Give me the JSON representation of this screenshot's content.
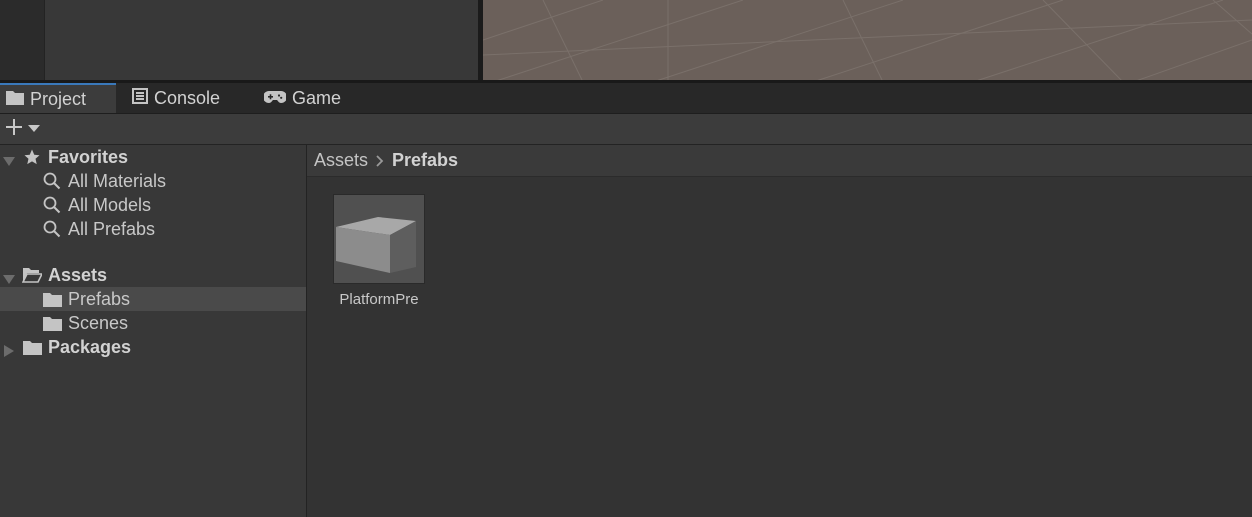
{
  "tabs": {
    "project": {
      "label": "Project",
      "icon": "folder-icon"
    },
    "console": {
      "label": "Console",
      "icon": "console-icon"
    },
    "game": {
      "label": "Game",
      "icon": "gamepad-icon"
    }
  },
  "toolbar": {
    "create_icon": "plus-icon",
    "create_dropdown_icon": "chevron-down-icon"
  },
  "tree": {
    "favorites": {
      "label": "Favorites",
      "expanded": true,
      "icon": "star-icon"
    },
    "favorites_items": [
      {
        "label": "All Materials",
        "icon": "search-icon"
      },
      {
        "label": "All Models",
        "icon": "search-icon"
      },
      {
        "label": "All Prefabs",
        "icon": "search-icon"
      }
    ],
    "assets": {
      "label": "Assets",
      "expanded": true,
      "icon": "folder-open-icon"
    },
    "assets_items": [
      {
        "label": "Prefabs",
        "icon": "folder-icon",
        "selected": true
      },
      {
        "label": "Scenes",
        "icon": "folder-icon",
        "selected": false
      }
    ],
    "packages": {
      "label": "Packages",
      "expanded": false,
      "icon": "folder-icon"
    }
  },
  "breadcrumb": {
    "root": "Assets",
    "current": "Prefabs"
  },
  "assets_grid": [
    {
      "label": "PlatformPre",
      "icon": "prefab-cube-icon"
    }
  ],
  "colors": {
    "accent": "#3a79bb",
    "scene_bg": "#6b605a",
    "panel_bg": "#383838",
    "content_bg": "#333333"
  }
}
